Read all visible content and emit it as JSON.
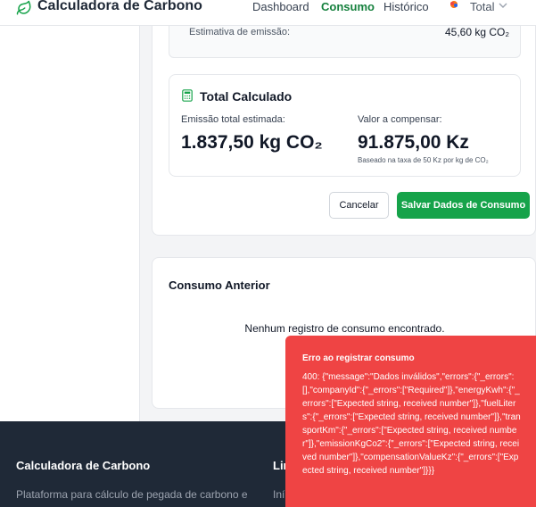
{
  "header": {
    "app_title": "Calculadora de Carbono",
    "nav": [
      {
        "label": "Dashboard",
        "active": false
      },
      {
        "label": "Consumo",
        "active": true
      },
      {
        "label": "Histórico",
        "active": false
      }
    ],
    "company_label": "Total",
    "brand_color": "#16a34a"
  },
  "form": {
    "estimate_label": "Estimativa de emissão:",
    "estimate_value": "45,60 kg CO₂"
  },
  "total": {
    "title": "Total Calculado",
    "emission_label": "Emissão total estimada:",
    "emission_value": "1.837,50 kg CO₂",
    "compensation_label": "Valor a compensar:",
    "compensation_value": "91.875,00 Kz",
    "compensation_note": "Baseado na taxa de 50 Kz por kg de CO₂"
  },
  "actions": {
    "cancel_label": "Cancelar",
    "save_label": "Salvar Dados de Consumo"
  },
  "previous": {
    "title": "Consumo Anterior",
    "empty_message": "Nenhum registro de consumo encontrado."
  },
  "footer": {
    "title": "Calculadora de Carbono",
    "description": "Plataforma para cálculo de pegada de carbono e",
    "second_title": "Lin",
    "second_link": "Iní"
  },
  "toast": {
    "title": "Erro ao registrar consumo",
    "message": "400: {\"message\":\"Dados inválidos\",\"errors\":{\"_errors\":[],\"companyId\":{\"_errors\":[\"Required\"]},\"energyKwh\":{\"_errors\":[\"Expected string, received number\"]},\"fuelLiters\":{\"_errors\":[\"Expected string, received number\"]},\"transportKm\":{\"_errors\":[\"Expected string, received number\"]},\"emissionKgCo2\":{\"_errors\":[\"Expected string, received number\"]},\"compensationValueKz\":{\"_errors\":[\"Expected string, received number\"]}}}",
    "color": "#ef4444"
  }
}
